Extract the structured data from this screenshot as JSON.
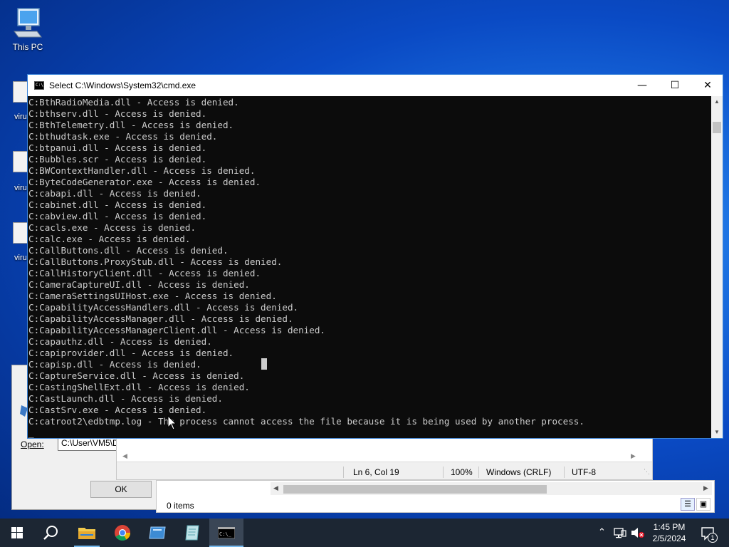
{
  "desktop": {
    "this_pc_label": "This PC",
    "partial_labels": [
      "viru",
      "viru",
      "viru"
    ]
  },
  "run_dialog": {
    "open_label": "Open:",
    "input_value": "C:\\User\\VM5\\D",
    "ok_label": "OK"
  },
  "notepad": {
    "position": "Ln 6, Col 19",
    "zoom": "100%",
    "line_ending": "Windows (CRLF)",
    "encoding": "UTF-8"
  },
  "explorer": {
    "items_count": "0 items"
  },
  "cmd": {
    "title": "Select C:\\Windows\\System32\\cmd.exe",
    "icon_text": "C:\\",
    "controls": {
      "minimize": "—",
      "maximize": "☐",
      "close": "✕"
    },
    "lines": [
      "C:BthRadioMedia.dll - Access is denied.",
      "C:bthserv.dll - Access is denied.",
      "C:BthTelemetry.dll - Access is denied.",
      "C:bthudtask.exe - Access is denied.",
      "C:btpanui.dll - Access is denied.",
      "C:Bubbles.scr - Access is denied.",
      "C:BWContextHandler.dll - Access is denied.",
      "C:ByteCodeGenerator.exe - Access is denied.",
      "C:cabapi.dll - Access is denied.",
      "C:cabinet.dll - Access is denied.",
      "C:cabview.dll - Access is denied.",
      "C:cacls.exe - Access is denied.",
      "C:calc.exe - Access is denied.",
      "C:CallButtons.dll - Access is denied.",
      "C:CallButtons.ProxyStub.dll - Access is denied.",
      "C:CallHistoryClient.dll - Access is denied.",
      "C:CameraCaptureUI.dll - Access is denied.",
      "C:CameraSettingsUIHost.exe - Access is denied.",
      "C:CapabilityAccessHandlers.dll - Access is denied.",
      "C:CapabilityAccessManager.dll - Access is denied.",
      "C:CapabilityAccessManagerClient.dll - Access is denied.",
      "C:capauthz.dll - Access is denied.",
      "C:capiprovider.dll - Access is denied.",
      "C:capisp.dll - Access is denied.",
      "C:CaptureService.dll - Access is denied.",
      "C:CastingShellExt.dll - Access is denied.",
      "C:CastLaunch.dll - Access is denied.",
      "C:CastSrv.exe - Access is denied.",
      "C:catroot2\\edbtmp.log - The process cannot access the file because it is being used by another process.",
      "_"
    ]
  },
  "taskbar": {
    "time": "1:45 PM",
    "date": "2/5/2024",
    "notification_count": "1",
    "apps": [
      "start",
      "search",
      "file-explorer",
      "chrome",
      "app-blue",
      "notepad",
      "cmd"
    ]
  },
  "colors": {
    "console_bg": "#0c0c0c",
    "console_fg": "#cccccc",
    "taskbar_bg": "#1c2633",
    "accent": "#76b9ed"
  }
}
